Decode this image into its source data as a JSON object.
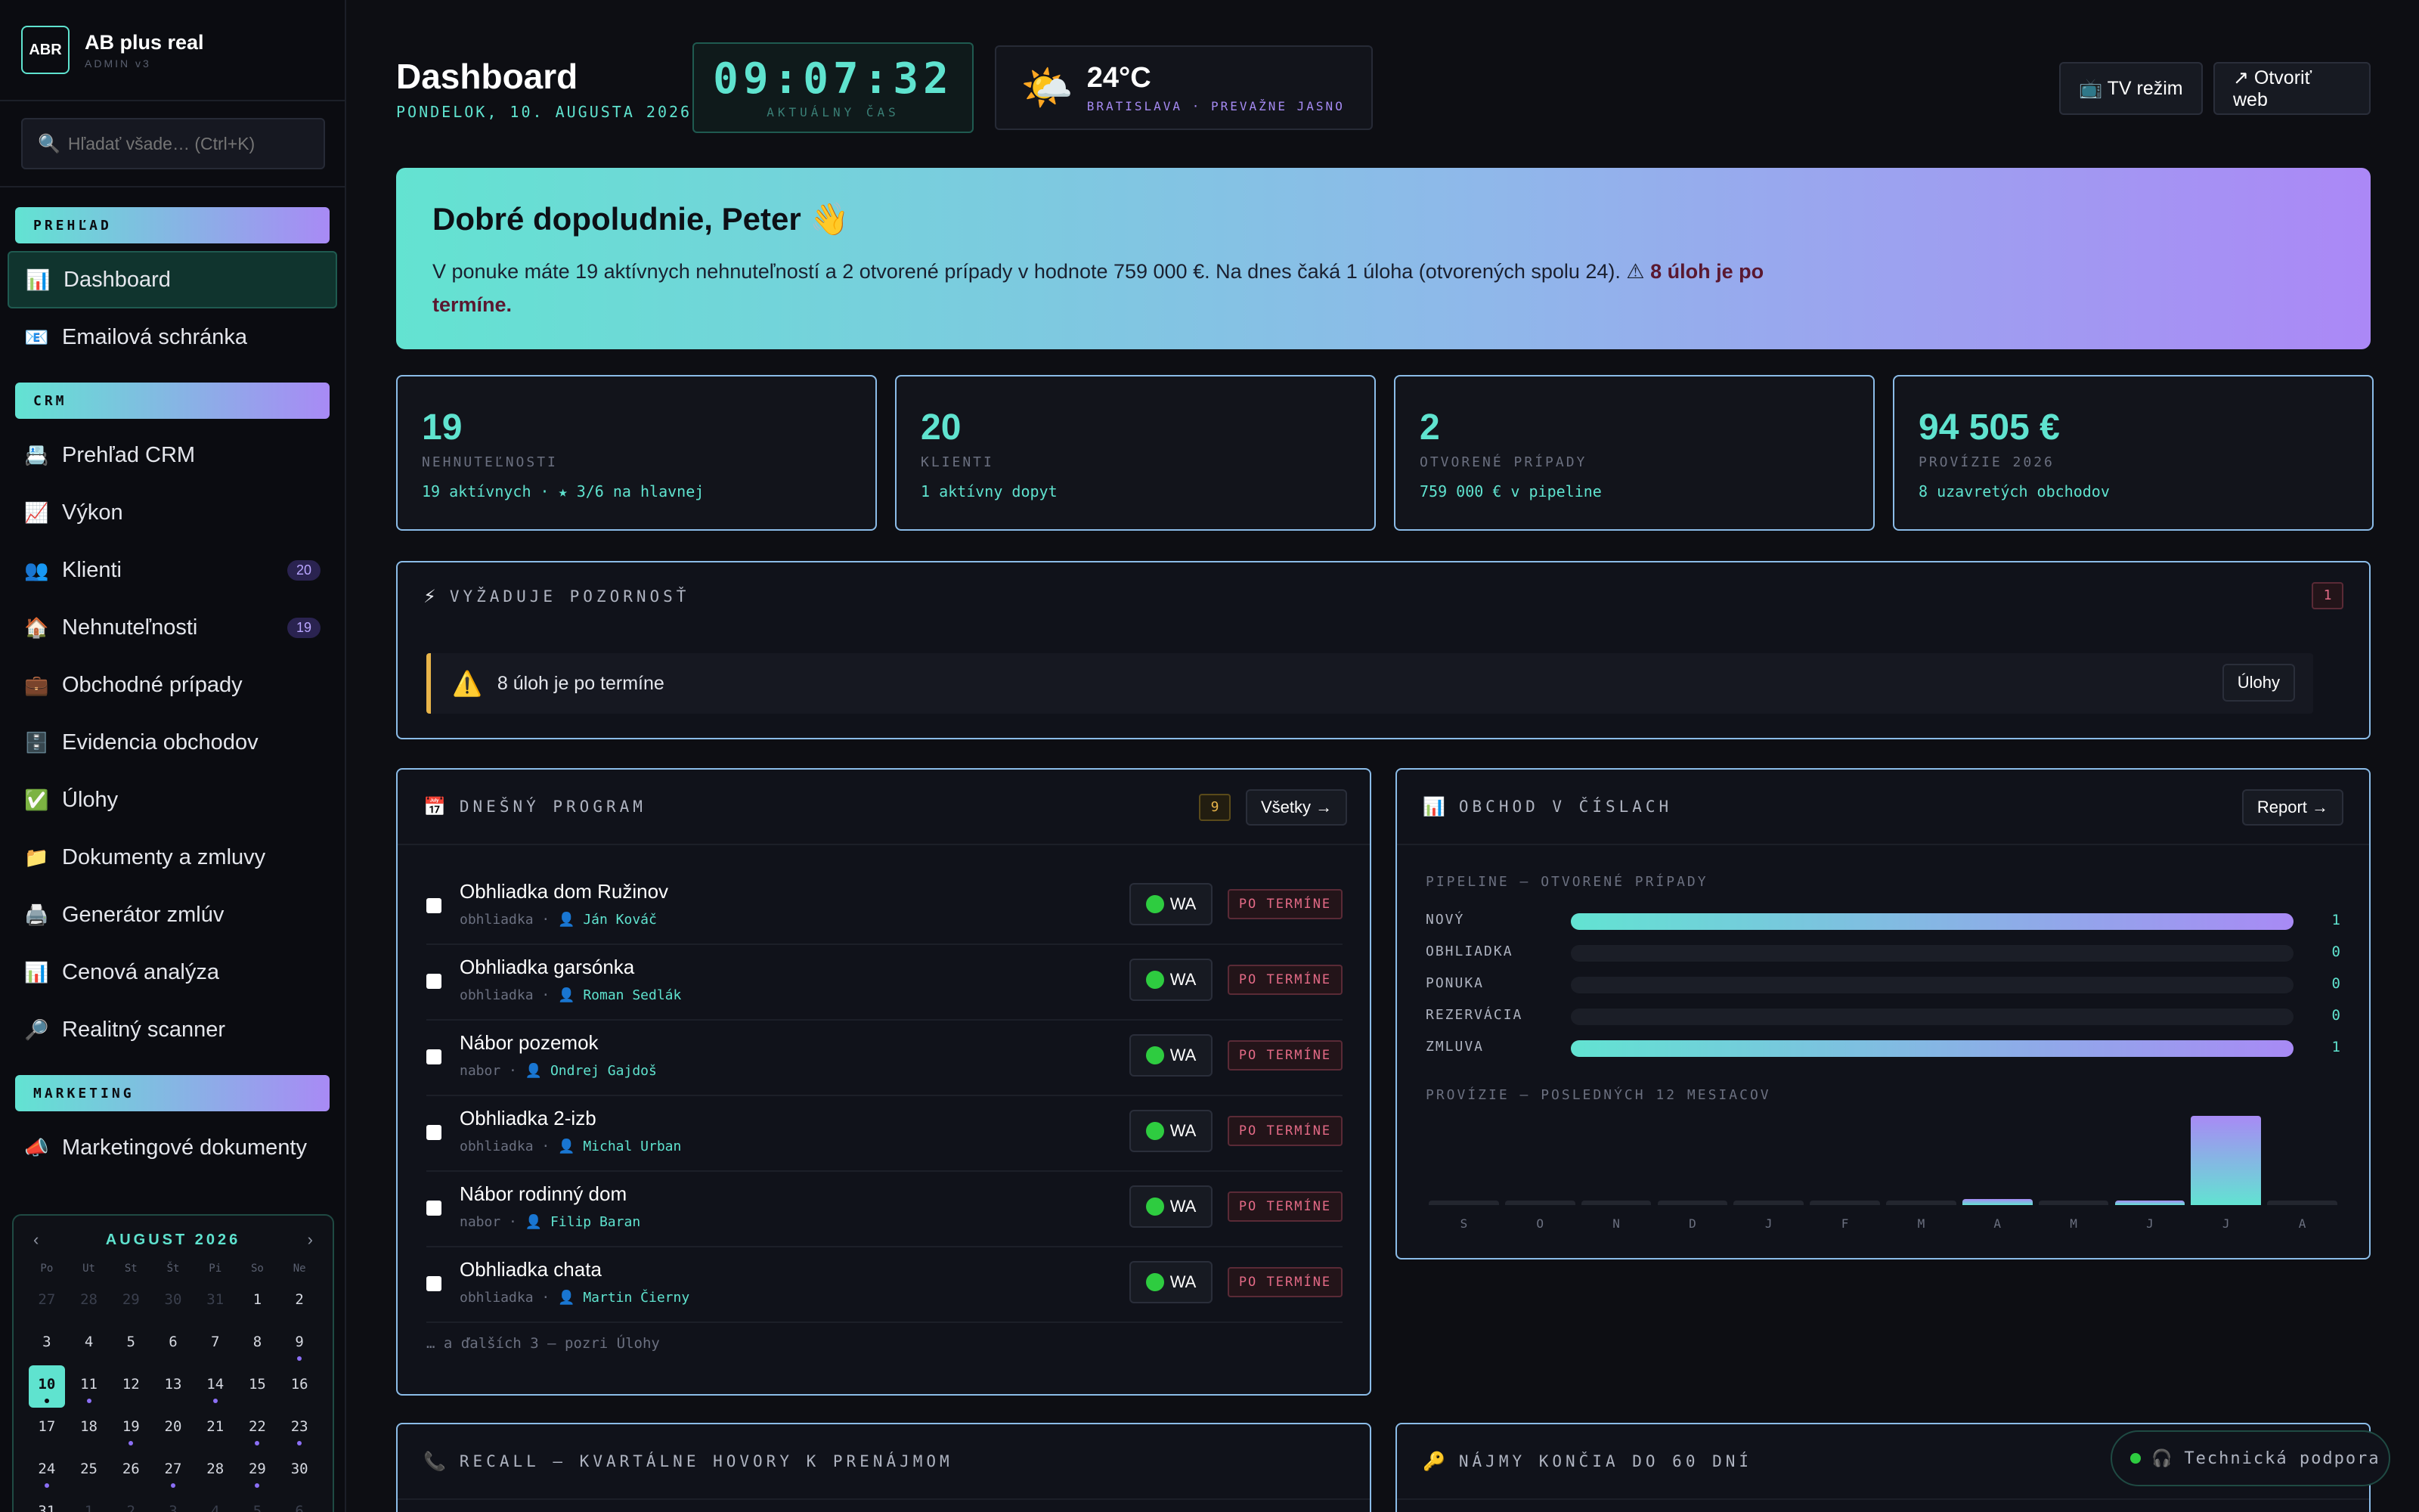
{
  "brand": {
    "logo": "ABR",
    "name": "AB plus real",
    "sub": "ADMIN v3"
  },
  "search": {
    "placeholder": "Hľadať všade… (Ctrl+K)"
  },
  "sidebar": {
    "sections": [
      {
        "label": "PREHĽAD",
        "items": [
          {
            "icon": "📊",
            "label": "Dashboard",
            "active": true
          },
          {
            "icon": "📧",
            "label": "Emailová schránka"
          }
        ]
      },
      {
        "label": "CRM",
        "items": [
          {
            "icon": "📇",
            "label": "Prehľad CRM"
          },
          {
            "icon": "📈",
            "label": "Výkon"
          },
          {
            "icon": "👥",
            "label": "Klienti",
            "badge": "20"
          },
          {
            "icon": "🏠",
            "label": "Nehnuteľnosti",
            "badge": "19"
          },
          {
            "icon": "💼",
            "label": "Obchodné prípady"
          },
          {
            "icon": "🗄️",
            "label": "Evidencia obchodov"
          },
          {
            "icon": "✅",
            "label": "Úlohy"
          },
          {
            "icon": "📁",
            "label": "Dokumenty a zmluvy"
          },
          {
            "icon": "🖨️",
            "label": "Generátor zmlúv"
          },
          {
            "icon": "📊",
            "label": "Cenová analýza"
          },
          {
            "icon": "🔎",
            "label": "Realitný scanner"
          }
        ]
      },
      {
        "label": "MARKETING",
        "items": [
          {
            "icon": "📣",
            "label": "Marketingové dokumenty"
          }
        ]
      }
    ]
  },
  "calendar": {
    "month": "AUGUST 2026",
    "prev": "‹",
    "next": "›",
    "dow": [
      "Po",
      "Ut",
      "St",
      "Št",
      "Pi",
      "So",
      "Ne"
    ],
    "days": [
      {
        "d": "27",
        "o": true
      },
      {
        "d": "28",
        "o": true
      },
      {
        "d": "29",
        "o": true
      },
      {
        "d": "30",
        "o": true
      },
      {
        "d": "31",
        "o": true
      },
      {
        "d": "1"
      },
      {
        "d": "2"
      },
      {
        "d": "3"
      },
      {
        "d": "4"
      },
      {
        "d": "5"
      },
      {
        "d": "6"
      },
      {
        "d": "7"
      },
      {
        "d": "8"
      },
      {
        "d": "9",
        "dot": true
      },
      {
        "d": "10",
        "today": true,
        "dot": true
      },
      {
        "d": "11",
        "dot": true
      },
      {
        "d": "12"
      },
      {
        "d": "13"
      },
      {
        "d": "14",
        "dot": true
      },
      {
        "d": "15"
      },
      {
        "d": "16"
      },
      {
        "d": "17"
      },
      {
        "d": "18"
      },
      {
        "d": "19",
        "dot": true
      },
      {
        "d": "20"
      },
      {
        "d": "21"
      },
      {
        "d": "22",
        "dot": true
      },
      {
        "d": "23",
        "dot": true
      },
      {
        "d": "24",
        "dot": true
      },
      {
        "d": "25"
      },
      {
        "d": "26"
      },
      {
        "d": "27",
        "dot": true
      },
      {
        "d": "28"
      },
      {
        "d": "29",
        "dot": true
      },
      {
        "d": "30"
      },
      {
        "d": "31"
      },
      {
        "d": "1",
        "o": true
      },
      {
        "d": "2",
        "o": true
      },
      {
        "d": "3",
        "o": true
      },
      {
        "d": "4",
        "o": true
      },
      {
        "d": "5",
        "o": true
      },
      {
        "d": "6",
        "o": true
      }
    ]
  },
  "header": {
    "title": "Dashboard",
    "date": "PONDELOK, 10. AUGUSTA 2026",
    "clock": "09:07:32",
    "clock_label": "AKTUÁLNY ČAS",
    "weather_icon": "🌤️",
    "temp": "24°C",
    "location": "BRATISLAVA · PREVAŽNE JASNO",
    "tv_button": "📺 TV režim",
    "web_button": "↗ Otvoriť web"
  },
  "hero": {
    "greeting": "Dobré dopoludnie, Peter 👋",
    "text": "V ponuke máte 19 aktívnych nehnuteľností a 2 otvorené prípady v hodnote 759 000 €. Na dnes čaká 1 úloha (otvorených spolu 24). ⚠ ",
    "warn": "8 úloh je po termíne."
  },
  "kpis": [
    {
      "value": "19",
      "label": "NEHNUTEĽNOSTI",
      "sub": "19 aktívnych · ★ 3/6 na hlavnej"
    },
    {
      "value": "20",
      "label": "KLIENTI",
      "sub": "1 aktívny dopyt"
    },
    {
      "value": "2",
      "label": "OTVORENÉ PRÍPADY",
      "sub": "759 000 € v pipeline"
    },
    {
      "value": "94 505 €",
      "label": "PROVÍZIE 2026",
      "sub": "8 uzavretých obchodov"
    }
  ],
  "attention": {
    "icon": "⚡",
    "title": "VYŽADUJE POZORNOSŤ",
    "count": "1",
    "alert_icon": "⚠️",
    "alert": "8 úloh je po termíne",
    "button": "Úlohy"
  },
  "program": {
    "icon": "📅",
    "title": "DNEŠNÝ PROGRAM",
    "count": "9",
    "all_button": "Všetky →",
    "wa": "WA",
    "late": "PO TERMÍNE",
    "tasks": [
      {
        "title": "Obhliadka dom Ružinov",
        "type": "obhliadka",
        "who": "Ján Kováč"
      },
      {
        "title": "Obhliadka garsónka",
        "type": "obhliadka",
        "who": "Roman Sedlák"
      },
      {
        "title": "Nábor pozemok",
        "type": "nabor",
        "who": "Ondrej Gajdoš"
      },
      {
        "title": "Obhliadka 2-izb",
        "type": "obhliadka",
        "who": "Michal Urban"
      },
      {
        "title": "Nábor rodinný dom",
        "type": "nabor",
        "who": "Filip Baran"
      },
      {
        "title": "Obhliadka chata",
        "type": "obhliadka",
        "who": "Martin Čierny"
      }
    ],
    "more": "… a ďalších 3 — pozri Úlohy"
  },
  "business": {
    "icon": "📊",
    "title": "OBCHOD V ČÍSLACH",
    "report_button": "Report →",
    "pipeline_title": "PIPELINE — OTVORENÉ PRÍPADY",
    "commission_title": "PROVÍZIE — POSLEDNÝCH 12 MESIACOV"
  },
  "chart_data": [
    {
      "type": "bar",
      "title": "PIPELINE — OTVORENÉ PRÍPADY",
      "categories": [
        "NOVÝ",
        "OBHLIADKA",
        "PONUKA",
        "REZERVÁCIA",
        "ZMLUVA"
      ],
      "values": [
        1,
        0,
        0,
        0,
        1
      ]
    },
    {
      "type": "bar",
      "title": "PROVÍZIE — POSLEDNÝCH 12 MESIACOV",
      "categories": [
        "S",
        "O",
        "N",
        "D",
        "J",
        "F",
        "M",
        "A",
        "M",
        "J",
        "J",
        "A"
      ],
      "values": [
        0,
        0,
        0,
        0,
        0,
        0,
        0,
        0.07,
        0,
        0.05,
        1,
        0
      ]
    }
  ],
  "bottom": {
    "recall_icon": "📞",
    "recall_title": "RECALL — KVARTÁLNE HOVORY K PRENÁJMOM",
    "lease_icon": "🔑",
    "lease_title": "NÁJMY KONČIA DO 60 DNÍ"
  },
  "support": {
    "icon": "🎧",
    "label": "Technická podpora"
  }
}
